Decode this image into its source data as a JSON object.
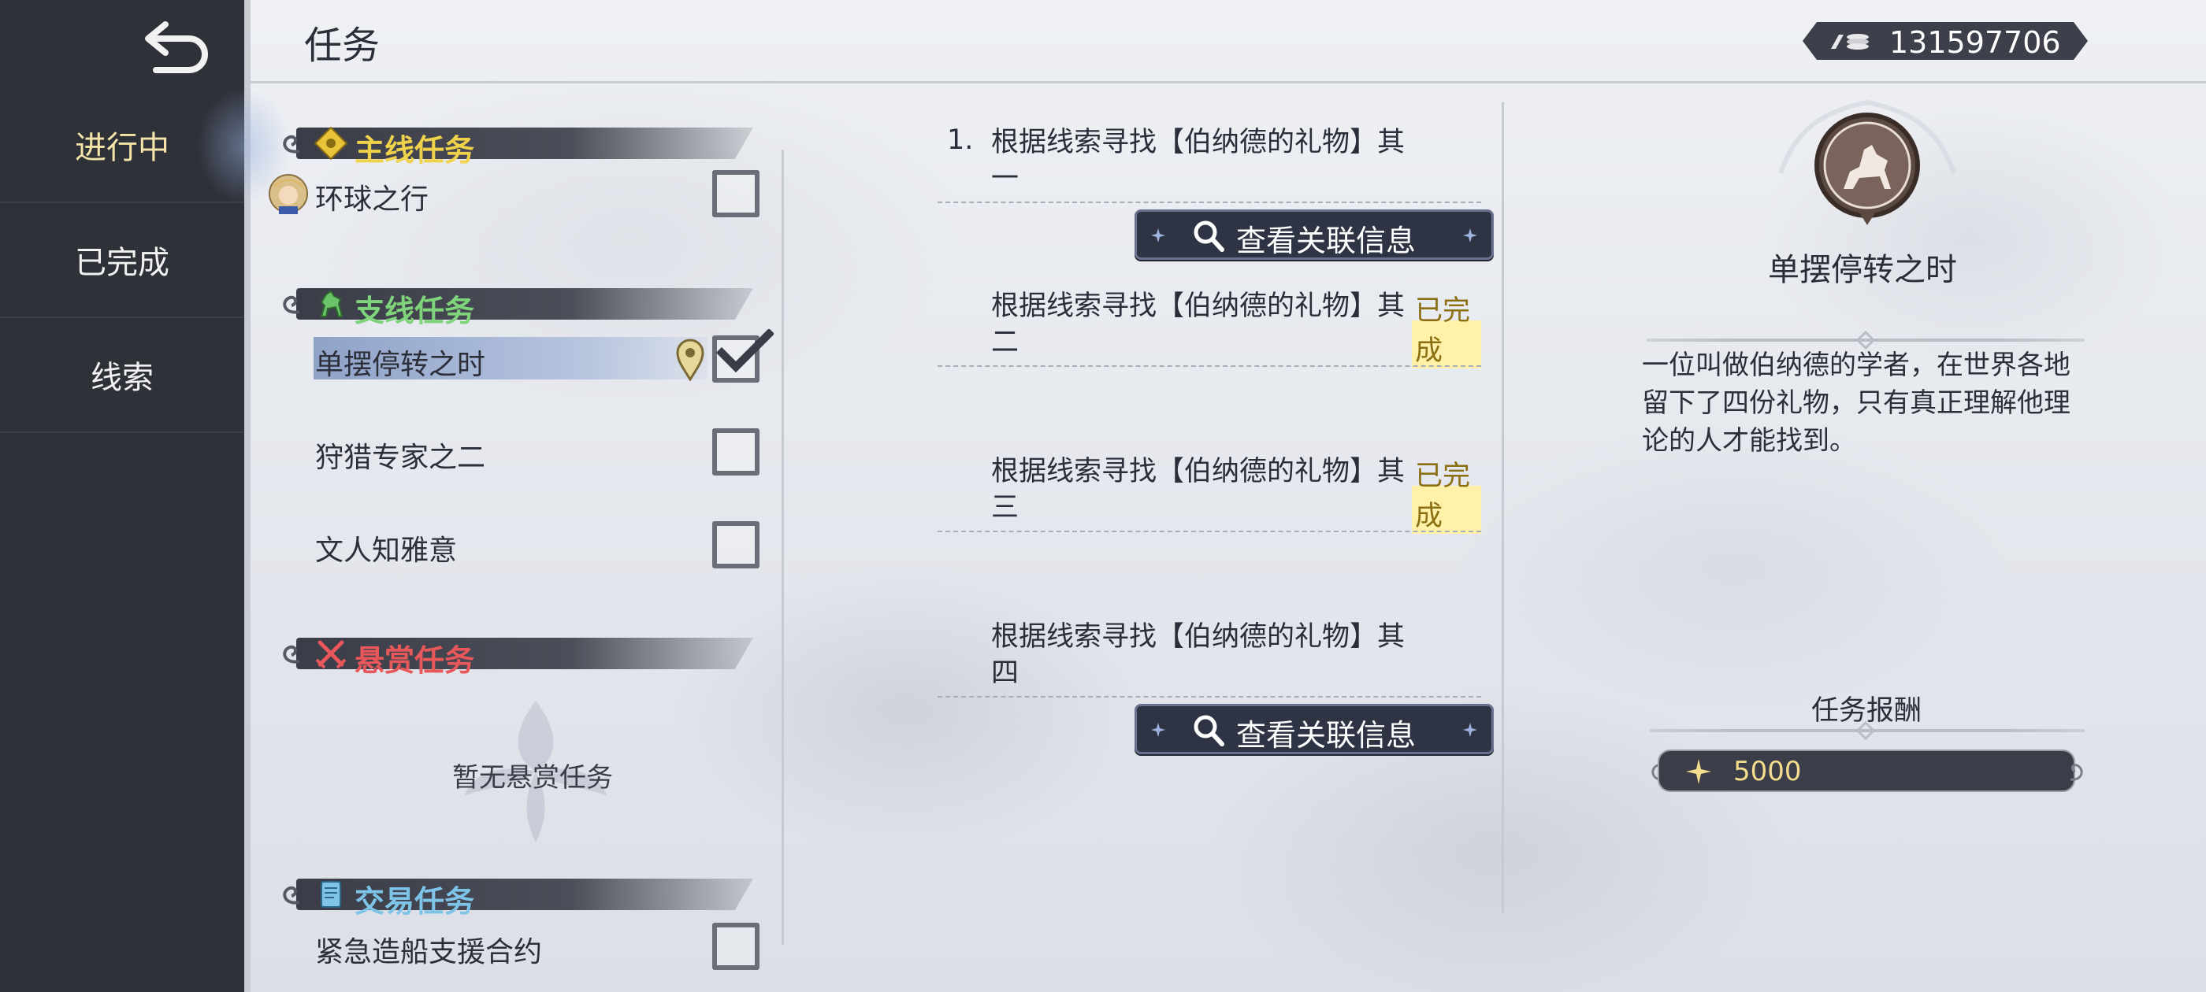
{
  "header": {
    "title": "任务",
    "currency_icon": "coin-stack-icon",
    "currency_value": "131597706"
  },
  "sidebar": {
    "back_icon": "back-arrow-icon",
    "items": [
      {
        "label": "进行中",
        "active": true
      },
      {
        "label": "已完成",
        "active": false
      },
      {
        "label": "线索",
        "active": false
      }
    ]
  },
  "quest_list": {
    "sections": [
      {
        "label": "主线任务",
        "icon": "main-quest-icon",
        "color": "#f0d24a",
        "items": [
          {
            "label": "环球之行",
            "checked": false,
            "selected": false
          }
        ]
      },
      {
        "label": "支线任务",
        "icon": "horse-icon",
        "color": "#7fd37a",
        "items": [
          {
            "label": "单摆停转之时",
            "checked": true,
            "selected": true
          },
          {
            "label": "狩猎专家之二",
            "checked": false,
            "selected": false
          },
          {
            "label": "文人知雅意",
            "checked": false,
            "selected": false
          }
        ]
      },
      {
        "label": "悬赏任务",
        "icon": "crossed-swords-icon",
        "color": "#e8585a",
        "items": [],
        "empty_text": "暂无悬赏任务"
      },
      {
        "label": "交易任务",
        "icon": "scroll-icon",
        "color": "#7ec3e8",
        "items": [
          {
            "label": "紧急造船支援合约",
            "checked": false,
            "selected": false
          }
        ]
      }
    ]
  },
  "objectives": [
    {
      "number": "1.",
      "line1": "根据线索寻找【伯纳德的礼物】其",
      "line2": "一",
      "status": ""
    },
    {
      "number": "",
      "line1": "根据线索寻找【伯纳德的礼物】其",
      "line2": "二",
      "status": "已完成"
    },
    {
      "number": "",
      "line1": "根据线索寻找【伯纳德的礼物】其",
      "line2": "三",
      "status": "已完成"
    },
    {
      "number": "",
      "line1": "根据线索寻找【伯纳德的礼物】其",
      "line2": "四",
      "status": ""
    }
  ],
  "info_button_label": "查看关联信息",
  "detail": {
    "emblem_icon": "knight-emblem-icon",
    "title": "单摆停转之时",
    "description": "一位叫做伯纳德的学者，在世界各地留下了四份礼物，只有真正理解他理论的人才能找到。",
    "reward_title": "任务报酬",
    "reward_icon": "sparkle-icon",
    "reward_value": "5000"
  }
}
